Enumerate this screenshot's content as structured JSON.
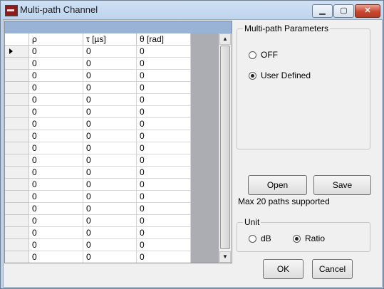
{
  "window": {
    "title": "Multi-path Channel",
    "accent": "#98b3d5"
  },
  "window_controls": {
    "minimize": "▁",
    "maximize": "▢",
    "close": "✕"
  },
  "table": {
    "columns": [
      "ρ",
      "τ [µs]",
      "θ [rad]"
    ],
    "rows": [
      [
        "0",
        "0",
        "0"
      ],
      [
        "0",
        "0",
        "0"
      ],
      [
        "0",
        "0",
        "0"
      ],
      [
        "0",
        "0",
        "0"
      ],
      [
        "0",
        "0",
        "0"
      ],
      [
        "0",
        "0",
        "0"
      ],
      [
        "0",
        "0",
        "0"
      ],
      [
        "0",
        "0",
        "0"
      ],
      [
        "0",
        "0",
        "0"
      ],
      [
        "0",
        "0",
        "0"
      ],
      [
        "0",
        "0",
        "0"
      ],
      [
        "0",
        "0",
        "0"
      ],
      [
        "0",
        "0",
        "0"
      ],
      [
        "0",
        "0",
        "0"
      ],
      [
        "0",
        "0",
        "0"
      ],
      [
        "0",
        "0",
        "0"
      ],
      [
        "0",
        "0",
        "0"
      ],
      [
        "0",
        "0",
        "0"
      ]
    ],
    "scroll_up": "▲",
    "scroll_down": "▼"
  },
  "multipath_params": {
    "legend": "Multi-path Parameters",
    "options": [
      "OFF",
      "User Defined"
    ],
    "selected": "User Defined"
  },
  "buttons": {
    "open": "Open",
    "save": "Save",
    "ok": "OK",
    "cancel": "Cancel"
  },
  "note": "Max 20 paths supported",
  "unit": {
    "legend": "Unit",
    "options": [
      "dB",
      "Ratio"
    ],
    "selected": "Ratio"
  }
}
